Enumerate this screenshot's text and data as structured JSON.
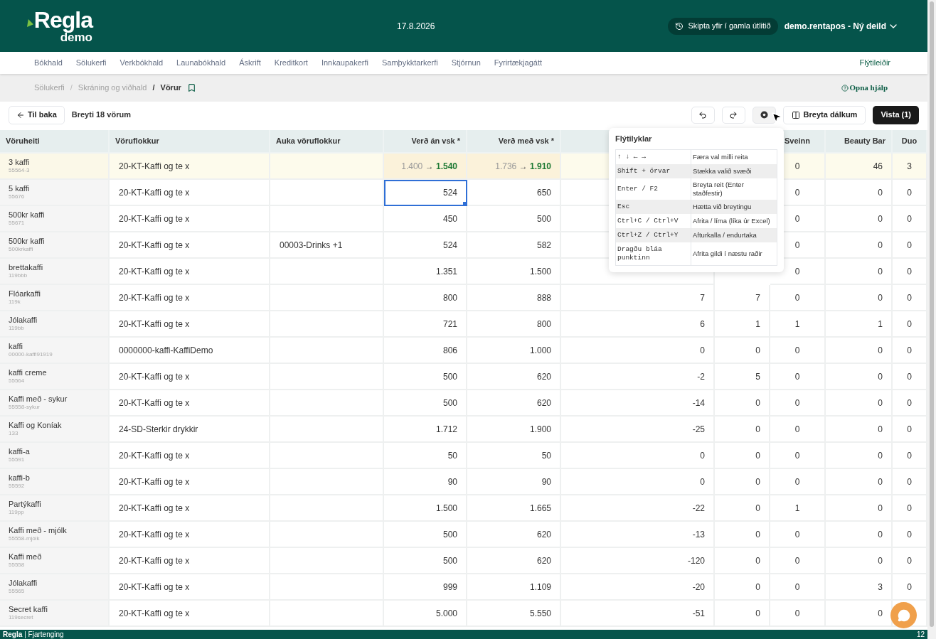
{
  "header": {
    "logo": "Regla",
    "logo_sub": "demo",
    "date": "17.8.2026",
    "switch_button": "Skipta yfir í gamla útlitið",
    "account": "demo.rentapos - Ný deild"
  },
  "nav": {
    "items": [
      "Bókhald",
      "Sölukerfi",
      "Verkbókhald",
      "Launabókhald",
      "Áskrift",
      "Kreditkort",
      "Innkaupakerfi",
      "Samþykktarkerfi",
      "Stjórnun",
      "Fyrirtækjagátt"
    ],
    "shortcuts": "Flýtileiðir"
  },
  "breadcrumb": {
    "items": [
      "Sölukerfi",
      "Skráning og viðhald",
      "Vörur"
    ],
    "separator": "/",
    "help": "Opna hjálp"
  },
  "toolbar": {
    "back": "Til baka",
    "title": "Breyti 18 vörum",
    "columns_button": "Breyta dálkum",
    "save_button": "Vista (1)"
  },
  "columns": [
    "Vöruheiti",
    "Vöruflokkur",
    "Auka vöruflokkur",
    "Verð án vsk *",
    "Verð með vsk *",
    "Sveinn",
    "Beauty Bar",
    "Duo"
  ],
  "change_arrow": "→",
  "rows": [
    {
      "kind": "changed",
      "name": "3 kaffi",
      "sku": "55564-3",
      "category": "20-KT-Kaffi og te x",
      "price_from": "1.400",
      "price_to": "1.540",
      "price_vat_from": "1.736",
      "price_vat_to": "1.910",
      "sveinn": "0",
      "beauty_bar": "46",
      "duo": "3",
      "price_selected": false
    },
    {
      "kind": "plain",
      "name": "5 kaffi",
      "sku": "55676",
      "category": "20-KT-Kaffi og te x",
      "price": "524",
      "price_vat": "650",
      "sveinn": "0",
      "beauty_bar": "0",
      "duo": "0",
      "price_selected": true
    },
    {
      "kind": "plain",
      "name": "500kr kaffi",
      "sku": "55671",
      "category": "20-KT-Kaffi og te x",
      "price": "450",
      "price_vat": "500",
      "sveinn": "0",
      "beauty_bar": "0",
      "duo": "0",
      "price_selected": false
    },
    {
      "kind": "plain",
      "name": "500kr kaffi",
      "sku": "500krkaffi",
      "category": "20-KT-Kaffi og te x",
      "extra_category": "00003-Drinks +1",
      "price": "524",
      "price_vat": "582",
      "sveinn": "0",
      "beauty_bar": "0",
      "duo": "0",
      "price_selected": false
    },
    {
      "kind": "plain",
      "name": "brettakaffi",
      "sku": "119bbb",
      "category": "20-KT-Kaffi og te x",
      "price": "1.351",
      "price_vat": "1.500",
      "sveinn": "0",
      "beauty_bar": "0",
      "duo": "0",
      "price_selected": false
    },
    {
      "kind": "plain",
      "name": "Flóarkaffi",
      "sku": "119k",
      "category": "20-KT-Kaffi og te x",
      "price": "800",
      "price_vat": "888",
      "column_6": "7",
      "column_7": "7",
      "sveinn": "0",
      "beauty_bar": "0",
      "duo": "0",
      "price_selected": false
    },
    {
      "kind": "plain",
      "name": "Jólakaffi",
      "sku": "119bb",
      "category": "20-KT-Kaffi og te x",
      "price": "721",
      "price_vat": "800",
      "column_6": "6",
      "column_7": "1",
      "sveinn": "1",
      "beauty_bar": "1",
      "duo": "0",
      "price_selected": false
    },
    {
      "kind": "plain",
      "name": "kaffi",
      "sku": "00000-kaffi91919",
      "category": "0000000-kaffi-KaffiDemo",
      "price": "806",
      "price_vat": "1.000",
      "column_6": "0",
      "column_7": "0",
      "sveinn": "0",
      "beauty_bar": "0",
      "duo": "0",
      "price_selected": false
    },
    {
      "kind": "plain",
      "name": "kaffi creme",
      "sku": "55564",
      "category": "20-KT-Kaffi og te x",
      "price": "500",
      "price_vat": "620",
      "column_6": "-2",
      "column_7": "5",
      "sveinn": "0",
      "beauty_bar": "0",
      "duo": "0",
      "price_selected": false
    },
    {
      "kind": "plain",
      "name": "Kaffi með - sykur",
      "sku": "55558-sykur",
      "category": "20-KT-Kaffi og te x",
      "price": "500",
      "price_vat": "620",
      "column_6": "-14",
      "column_7": "0",
      "sveinn": "0",
      "beauty_bar": "0",
      "duo": "0",
      "price_selected": false
    },
    {
      "kind": "plain",
      "name": "Kaffi og Koníak",
      "sku": "133",
      "category": "24-SD-Sterkir drykkir",
      "price": "1.712",
      "price_vat": "1.900",
      "column_6": "-25",
      "column_7": "0",
      "sveinn": "0",
      "beauty_bar": "0",
      "duo": "0",
      "price_selected": false
    },
    {
      "kind": "plain",
      "name": "kaffi-a",
      "sku": "55591",
      "category": "20-KT-Kaffi og te x",
      "price": "50",
      "price_vat": "50",
      "column_6": "0",
      "column_7": "0",
      "sveinn": "0",
      "beauty_bar": "0",
      "duo": "0",
      "price_selected": false
    },
    {
      "kind": "plain",
      "name": "kaffi-b",
      "sku": "55592",
      "category": "20-KT-Kaffi og te x",
      "price": "90",
      "price_vat": "90",
      "column_6": "0",
      "column_7": "0",
      "sveinn": "0",
      "beauty_bar": "0",
      "duo": "0",
      "price_selected": false
    },
    {
      "kind": "plain",
      "name": "Partýkaffi",
      "sku": "119pp",
      "category": "20-KT-Kaffi og te x",
      "price": "1.500",
      "price_vat": "1.665",
      "column_6": "-22",
      "column_7": "0",
      "sveinn": "1",
      "beauty_bar": "0",
      "duo": "0",
      "price_selected": false
    },
    {
      "kind": "plain",
      "name": "Kaffi með - mjólk",
      "sku": "55558-mjólk",
      "category": "20-KT-Kaffi og te x",
      "price": "500",
      "price_vat": "620",
      "column_6": "-13",
      "column_7": "0",
      "sveinn": "0",
      "beauty_bar": "0",
      "duo": "0",
      "price_selected": false
    },
    {
      "kind": "plain",
      "name": "Kaffi með",
      "sku": "55558",
      "category": "20-KT-Kaffi og te x",
      "price": "500",
      "price_vat": "620",
      "column_6": "-120",
      "column_7": "0",
      "sveinn": "0",
      "beauty_bar": "0",
      "duo": "0",
      "price_selected": false
    },
    {
      "kind": "plain",
      "name": "Jólakaffi",
      "sku": "55565",
      "category": "20-KT-Kaffi og te x",
      "price": "999",
      "price_vat": "1.109",
      "column_6": "-20",
      "column_7": "0",
      "sveinn": "0",
      "beauty_bar": "3",
      "duo": "0",
      "price_selected": false
    },
    {
      "kind": "plain",
      "name": "Secret kaffi",
      "sku": "119secret",
      "category": "20-KT-Kaffi og te x",
      "price": "5.000",
      "price_vat": "5.550",
      "column_6": "-51",
      "column_7": "0",
      "sveinn": "0",
      "beauty_bar": "0",
      "price_selected": false
    }
  ],
  "shortcuts_popover": {
    "title": "Flýtilyklar",
    "items": [
      {
        "keys": "↑ ↓ ← →",
        "action": "Færa val milli reita"
      },
      {
        "keys": "Shift + örvar",
        "action": "Stækka valið svæði"
      },
      {
        "keys": "Enter / F2",
        "action": "Breyta reit (Enter staðfestir)"
      },
      {
        "keys": "Esc",
        "action": "Hætta við breytingu"
      },
      {
        "keys": "Ctrl+C / Ctrl+V",
        "action": "Afrita / líma (líka úr Excel)"
      },
      {
        "keys": "Ctrl+Z / Ctrl+Y",
        "action": "Afturkalla / endurtaka"
      },
      {
        "keys": "Dragðu bláa punktinn",
        "action": "Afrita gildi í næstu raðir"
      }
    ]
  },
  "footer": {
    "logo": "Regla",
    "label": "| Fjartenging",
    "page": "12"
  }
}
